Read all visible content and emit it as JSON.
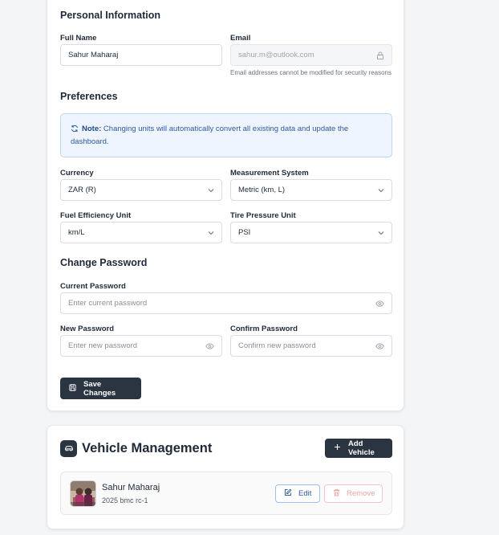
{
  "personal": {
    "title": "Personal Information",
    "full_name_label": "Full Name",
    "full_name_value": "Sahur Maharaj",
    "email_label": "Email",
    "email_value": "sahur.m@outlook.com",
    "email_hint": "Email addresses cannot be modified for security reasons"
  },
  "preferences": {
    "title": "Preferences",
    "note_label": "Note:",
    "note_text": "Changing units will automatically convert all existing data and update the dashboard.",
    "currency_label": "Currency",
    "currency_value": "ZAR (R)",
    "measurement_label": "Measurement System",
    "measurement_value": "Metric (km, L)",
    "fuel_label": "Fuel Efficiency Unit",
    "fuel_value": "km/L",
    "tire_label": "Tire Pressure Unit",
    "tire_value": "PSI"
  },
  "password": {
    "title": "Change Password",
    "current_label": "Current Password",
    "current_placeholder": "Enter current password",
    "new_label": "New Password",
    "new_placeholder": "Enter new password",
    "confirm_label": "Confirm Password",
    "confirm_placeholder": "Confirm new password",
    "save_label": "Save Changes"
  },
  "vehicles": {
    "title": "Vehicle Management",
    "add_label": "Add Vehicle",
    "items": [
      {
        "name": "Sahur Maharaj",
        "description": "2025 bmc rc-1",
        "edit_label": "Edit",
        "remove_label": "Remove"
      }
    ]
  },
  "icons": {
    "refresh": "refresh-icon",
    "lock": "lock-icon",
    "chevron": "chevron-down-icon",
    "eye": "eye-icon",
    "save": "save-icon",
    "plus": "plus-icon",
    "car": "car-icon",
    "edit": "edit-icon",
    "trash": "trash-icon"
  },
  "colors": {
    "primary_dark": "#2b3441",
    "note_bg": "#eef5ff",
    "note_text": "#2c5aa0",
    "edit_border": "#9ec1ee",
    "remove_text": "#e9a3a3"
  }
}
